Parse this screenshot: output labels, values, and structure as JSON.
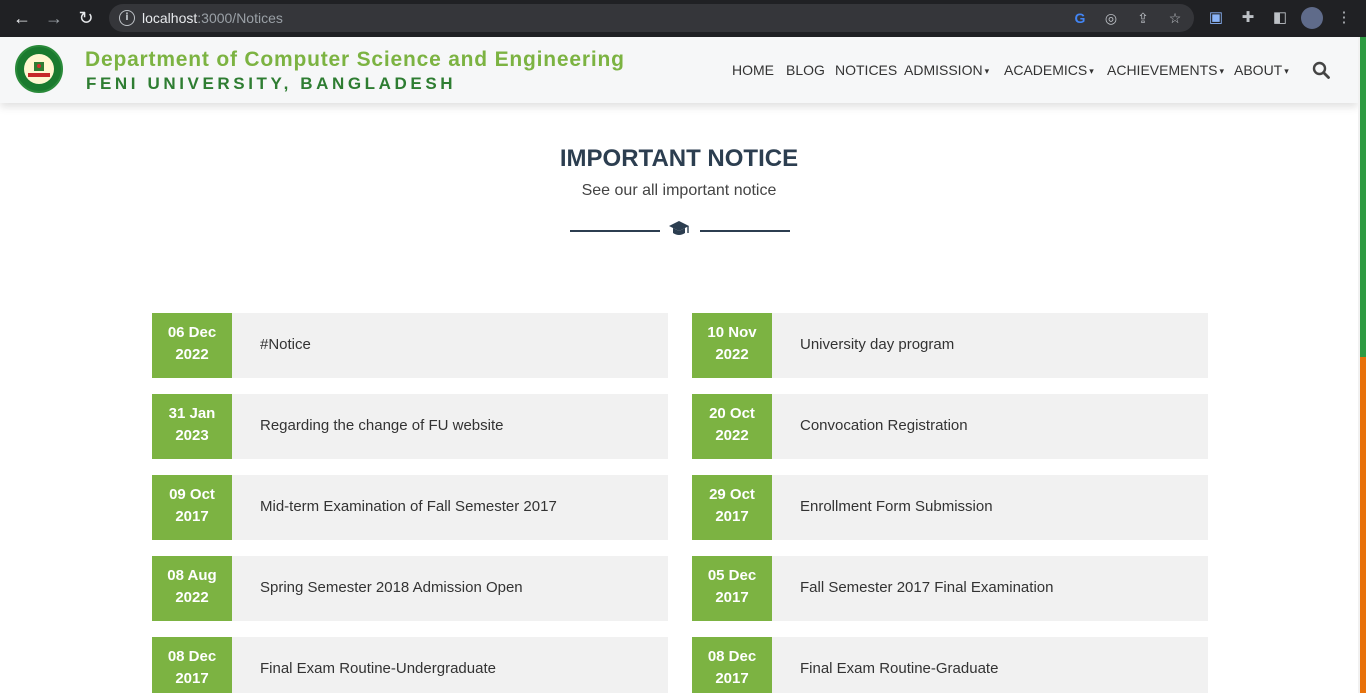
{
  "browser": {
    "url_host": "localhost",
    "url_path": ":3000/Notices"
  },
  "header": {
    "dept_title": "Department of Computer Science and Engineering",
    "university": "FENI UNIVERSITY, BANGLADESH",
    "menu": [
      {
        "label": "HOME",
        "dropdown": false
      },
      {
        "label": "BLOG",
        "dropdown": false
      },
      {
        "label": "NOTICES",
        "dropdown": false
      },
      {
        "label": "ADMISSION",
        "dropdown": true
      },
      {
        "label": "ACADEMICS",
        "dropdown": true
      },
      {
        "label": "ACHIEVEMENTS",
        "dropdown": true
      },
      {
        "label": "ABOUT",
        "dropdown": true
      }
    ],
    "caret": "▾"
  },
  "section": {
    "title": "IMPORTANT NOTICE",
    "subtitle": "See our all important notice"
  },
  "notices": {
    "left": [
      {
        "date1": "06 Dec",
        "date2": "2022",
        "title": "#Notice"
      },
      {
        "date1": "31 Jan",
        "date2": "2023",
        "title": "Regarding the change of FU website"
      },
      {
        "date1": "09 Oct",
        "date2": "2017",
        "title": "Mid-term Examination of Fall Semester 2017"
      },
      {
        "date1": "08 Aug",
        "date2": "2022",
        "title": "Spring Semester 2018 Admission Open"
      },
      {
        "date1": "08 Dec",
        "date2": "2017",
        "title": "Final Exam Routine-Undergraduate"
      }
    ],
    "right": [
      {
        "date1": "10 Nov",
        "date2": "2022",
        "title": "University day program"
      },
      {
        "date1": "20 Oct",
        "date2": "2022",
        "title": "Convocation Registration"
      },
      {
        "date1": "29 Oct",
        "date2": "2017",
        "title": "Enrollment Form Submission"
      },
      {
        "date1": "05 Dec",
        "date2": "2017",
        "title": "Fall Semester 2017 Final Examination"
      },
      {
        "date1": "08 Dec",
        "date2": "2017",
        "title": "Final Exam Routine-Graduate"
      }
    ]
  },
  "colors": {
    "accent_green": "#7cb342",
    "dark_green": "#2e7d32",
    "heading": "#2c3e50",
    "card_bg": "#f1f1f1"
  }
}
